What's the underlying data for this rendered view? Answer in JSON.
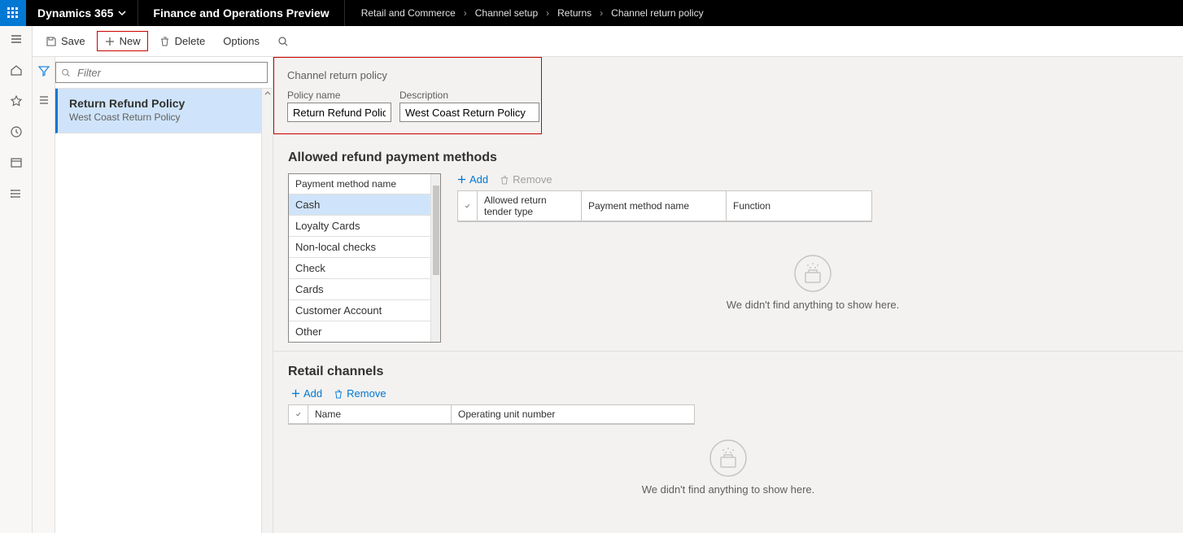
{
  "header": {
    "brand": "Dynamics 365",
    "module": "Finance and Operations Preview"
  },
  "breadcrumb": [
    "Retail and Commerce",
    "Channel setup",
    "Returns",
    "Channel return policy"
  ],
  "commands": {
    "save": "Save",
    "new": "New",
    "delete": "Delete",
    "options": "Options"
  },
  "filter": {
    "placeholder": "Filter"
  },
  "list": {
    "items": [
      {
        "title": "Return Refund Policy",
        "subtitle": "West Coast Return Policy"
      }
    ]
  },
  "form": {
    "section_label": "Channel return policy",
    "policy_name_label": "Policy name",
    "policy_name_value": "Return Refund Policy",
    "description_label": "Description",
    "description_value": "West Coast Return Policy"
  },
  "allowed": {
    "heading": "Allowed refund payment methods",
    "dropdown_header": "Payment method name",
    "dropdown_items": [
      "Cash",
      "Loyalty Cards",
      "Non-local checks",
      "Check",
      "Cards",
      "Customer Account",
      "Other"
    ],
    "toolbar": {
      "add": "Add",
      "remove": "Remove"
    },
    "grid_cols": [
      "Allowed return tender type",
      "Payment method name",
      "Function"
    ],
    "empty": "We didn't find anything to show here."
  },
  "retail": {
    "heading": "Retail channels",
    "toolbar": {
      "add": "Add",
      "remove": "Remove"
    },
    "grid_cols": [
      "Name",
      "Operating unit number"
    ],
    "empty": "We didn't find anything to show here."
  }
}
